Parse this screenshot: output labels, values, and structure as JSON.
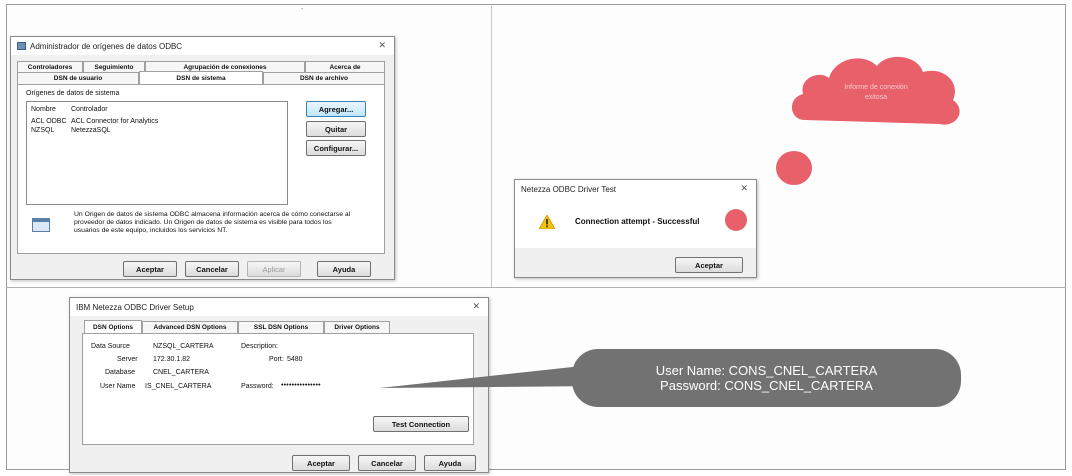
{
  "odbc_admin": {
    "title": "Administrador de orígenes de datos ODBC",
    "close": "✕",
    "tabs_row1": [
      "Controladores",
      "Seguimiento",
      "Agrupación de conexiones",
      "Acerca de"
    ],
    "tabs_row2": [
      "DSN de usuario",
      "DSN de sistema",
      "DSN de archivo"
    ],
    "group_label": "Orígenes de datos de sistema",
    "columns": [
      "Nombre",
      "Controlador"
    ],
    "rows": [
      {
        "name": "ACL ODBC",
        "driver": "ACL Connector for Analytics"
      },
      {
        "name": "NZSQL",
        "driver": "NetezzaSQL"
      }
    ],
    "side_buttons": [
      "Agregar...",
      "Quitar",
      "Configurar..."
    ],
    "info_text": "Un Origen de datos de sistema ODBC almacena información acerca de cómo conectarse al proveedor de datos indicado. Un Origen de datos de sistema es visible para todos los usuarios de este equipo, incluidos los servicios NT.",
    "buttons": [
      "Aceptar",
      "Cancelar",
      "Aplicar",
      "Ayuda"
    ]
  },
  "driver_test": {
    "title": "Netezza ODBC Driver Test",
    "close": "✕",
    "message": "Connection attempt - Successful",
    "ok_button": "Aceptar"
  },
  "driver_setup": {
    "title": "IBM Netezza ODBC Driver Setup",
    "close": "✕",
    "tabs": [
      "DSN Options",
      "Advanced DSN Options",
      "SSL DSN Options",
      "Driver Options"
    ],
    "data_source_label": "Data Source",
    "data_source_value": "NZSQL_CARTERA",
    "description_label": "Description:",
    "server_label": "Server",
    "server_value": "172.30.1.82",
    "port_label": "Port:",
    "port_value": "5480",
    "database_label": "Database",
    "database_value": "CNEL_CARTERA",
    "username_label": "User Name",
    "username_value": "IS_CNEL_CARTERA",
    "password_label": "Password:",
    "password_value": "•••••••••••••••",
    "test_button": "Test Connection",
    "buttons": [
      "Aceptar",
      "Cancelar",
      "Ayuda"
    ]
  },
  "cloud_note": {
    "line1": "Informe de conexión",
    "line2": "exitosa",
    "color": "#e8606a"
  },
  "callout": {
    "line1": "User Name: CONS_CNEL_CARTERA",
    "line2": "Password: CONS_CNEL_CARTERA",
    "color": "#727272"
  },
  "top_mark": "-"
}
